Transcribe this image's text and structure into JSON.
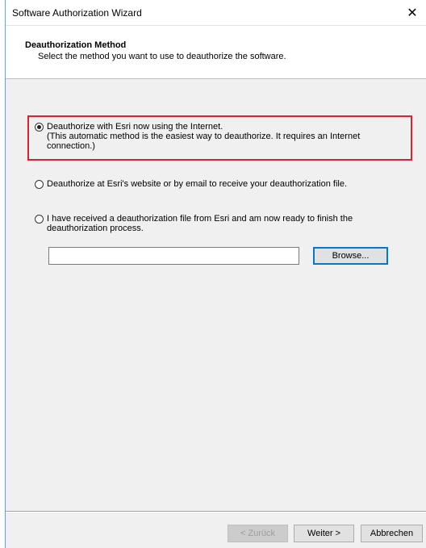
{
  "window": {
    "title": "Software Authorization Wizard",
    "close_symbol": "✕"
  },
  "header": {
    "title": "Deauthorization Method",
    "subtitle": "Select the method you want to use to deauthorize the software."
  },
  "options": [
    {
      "line1": "Deauthorize with Esri now using the Internet.",
      "line2": "(This automatic method is the easiest way to deauthorize. It requires an Internet",
      "line3": "connection.)",
      "selected": true
    },
    {
      "line1": "Deauthorize at Esri's website or by email to receive your deauthorization file.",
      "selected": false
    },
    {
      "line1": "I have received a deauthorization file from Esri and am now ready to finish the",
      "line2": "deauthorization process.",
      "selected": false
    }
  ],
  "file_field": {
    "value": "",
    "browse_label": "Browse..."
  },
  "footer": {
    "back_label": "< Zurück",
    "next_label": "Weiter >",
    "cancel_label": "Abbrechen"
  },
  "colors": {
    "highlight": "#e0202a",
    "default_button_border": "#0078d7"
  }
}
